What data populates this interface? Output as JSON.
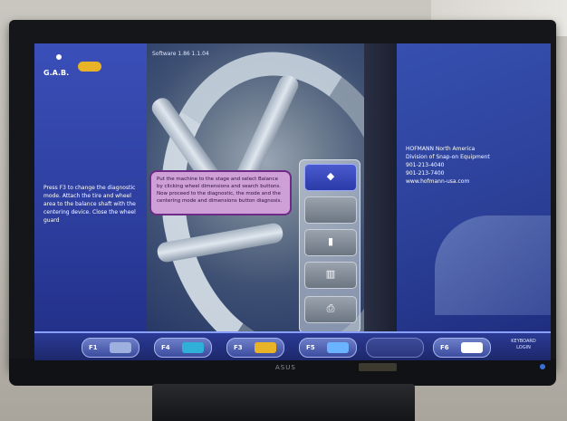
{
  "screen": {
    "software_info": "Software 1.86   1.1.04",
    "logo_text": "G.A.B.",
    "instructions": "Press F3 to change the diagnostic mode. Attach the tire and wheel area to the balance shaft with the centering device. Close the wheel guard",
    "tooltip_text": "Put the machine to the stage and select Balance by clicking wheel dimensions and search buttons. Now proceed to the diagnostic, the mode and the centering mode and dimensions button diagnosis.",
    "contact": {
      "company": "HOFMANN North America",
      "division": "Division of Snap-on Equipment",
      "phone": "901-213-4040",
      "fax": "901-213-7400",
      "web": "www.hofmann-usa.com"
    },
    "tool_menu": {
      "items": [
        {
          "name": "wheel-dimension-tool",
          "glyph": "◆",
          "active": true
        },
        {
          "name": "empty-slot",
          "glyph": "",
          "active": false
        },
        {
          "name": "weight-position-tool",
          "glyph": "▮",
          "active": false
        },
        {
          "name": "spoke-mode-tool",
          "glyph": "▥",
          "active": false
        },
        {
          "name": "print-tool",
          "glyph": "⎙",
          "active": false
        }
      ]
    },
    "function_keys": [
      {
        "label": "F1",
        "icon": "wheel-icon",
        "color": "#9fb0de",
        "disabled": false
      },
      {
        "label": "F4",
        "icon": "tire-info-icon",
        "color": "#2fb0d9",
        "disabled": false
      },
      {
        "label": "F3",
        "icon": "car-icon",
        "color": "#e8b327",
        "disabled": false
      },
      {
        "label": "F5",
        "icon": "balance-icon",
        "color": "#6ab3ff",
        "disabled": false
      },
      {
        "label": "",
        "icon": "",
        "color": "#4b5aa0",
        "disabled": true
      },
      {
        "label": "F6",
        "icon": "tools-icon",
        "color": "#ffffff",
        "disabled": false
      }
    ],
    "status_text": "KEYBOARD LOGIN"
  },
  "monitor": {
    "brand": "ASUS"
  }
}
